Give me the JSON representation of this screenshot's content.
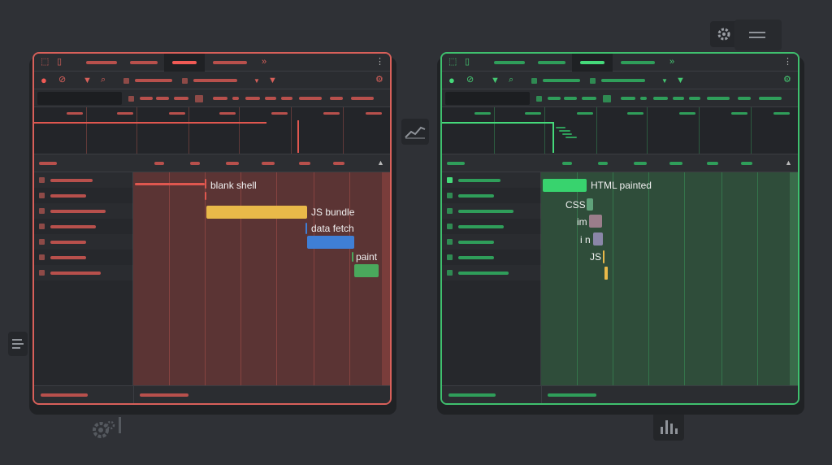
{
  "colors": {
    "background": "#2f3136",
    "slow_accent": "#d8605a",
    "fast_accent": "#3fc06e",
    "js_bar": "#e9b949",
    "fetch_bar": "#3f7fd6",
    "paint_bar": "#4aa85c",
    "html_bar": "#38d36e"
  },
  "icons": [
    "inspect-icon",
    "device-icon",
    "more-tabs-icon",
    "kebab-menu-icon",
    "record-icon",
    "clear-icon",
    "filter-icon",
    "search-icon",
    "settings-icon",
    "trend-chart-icon",
    "gear-icon",
    "bar-chart-icon",
    "menu-icon",
    "document-icon"
  ],
  "left_panel": {
    "labels": {
      "blank_shell": "blank shell",
      "js_bundle": "JS bundle",
      "data_fetch": "data fetch",
      "paint": "paint"
    }
  },
  "right_panel": {
    "labels": {
      "html_painted": "HTML painted",
      "css": "CSS",
      "im": "im",
      "in": "i n",
      "js": "JS"
    }
  },
  "glyphs": {
    "more": "»",
    "kebab": "⋮",
    "record": "●",
    "clear": "⊘",
    "filter": "▼",
    "search": "⌕",
    "gear": "⚙",
    "sort": "▲"
  }
}
